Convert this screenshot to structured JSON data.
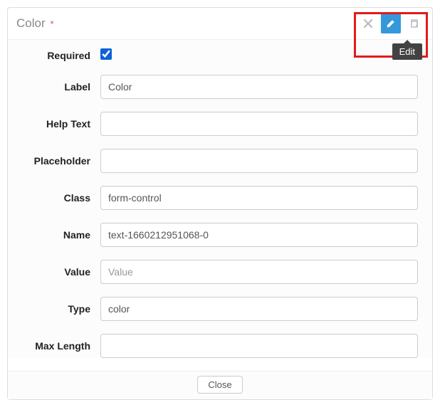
{
  "header": {
    "title": "Color",
    "required_marker": "*"
  },
  "tooltip": "Edit",
  "form": {
    "required": {
      "label": "Required",
      "checked": true
    },
    "label": {
      "label": "Label",
      "value": "Color"
    },
    "help_text": {
      "label": "Help Text",
      "value": ""
    },
    "placeholder": {
      "label": "Placeholder",
      "value": ""
    },
    "class": {
      "label": "Class",
      "value": "form-control"
    },
    "name": {
      "label": "Name",
      "value": "text-1660212951068-0"
    },
    "value": {
      "label": "Value",
      "value": "",
      "placeholder": "Value"
    },
    "type": {
      "label": "Type",
      "value": "color"
    },
    "max_length": {
      "label": "Max Length",
      "value": ""
    }
  },
  "close_button": "Close"
}
